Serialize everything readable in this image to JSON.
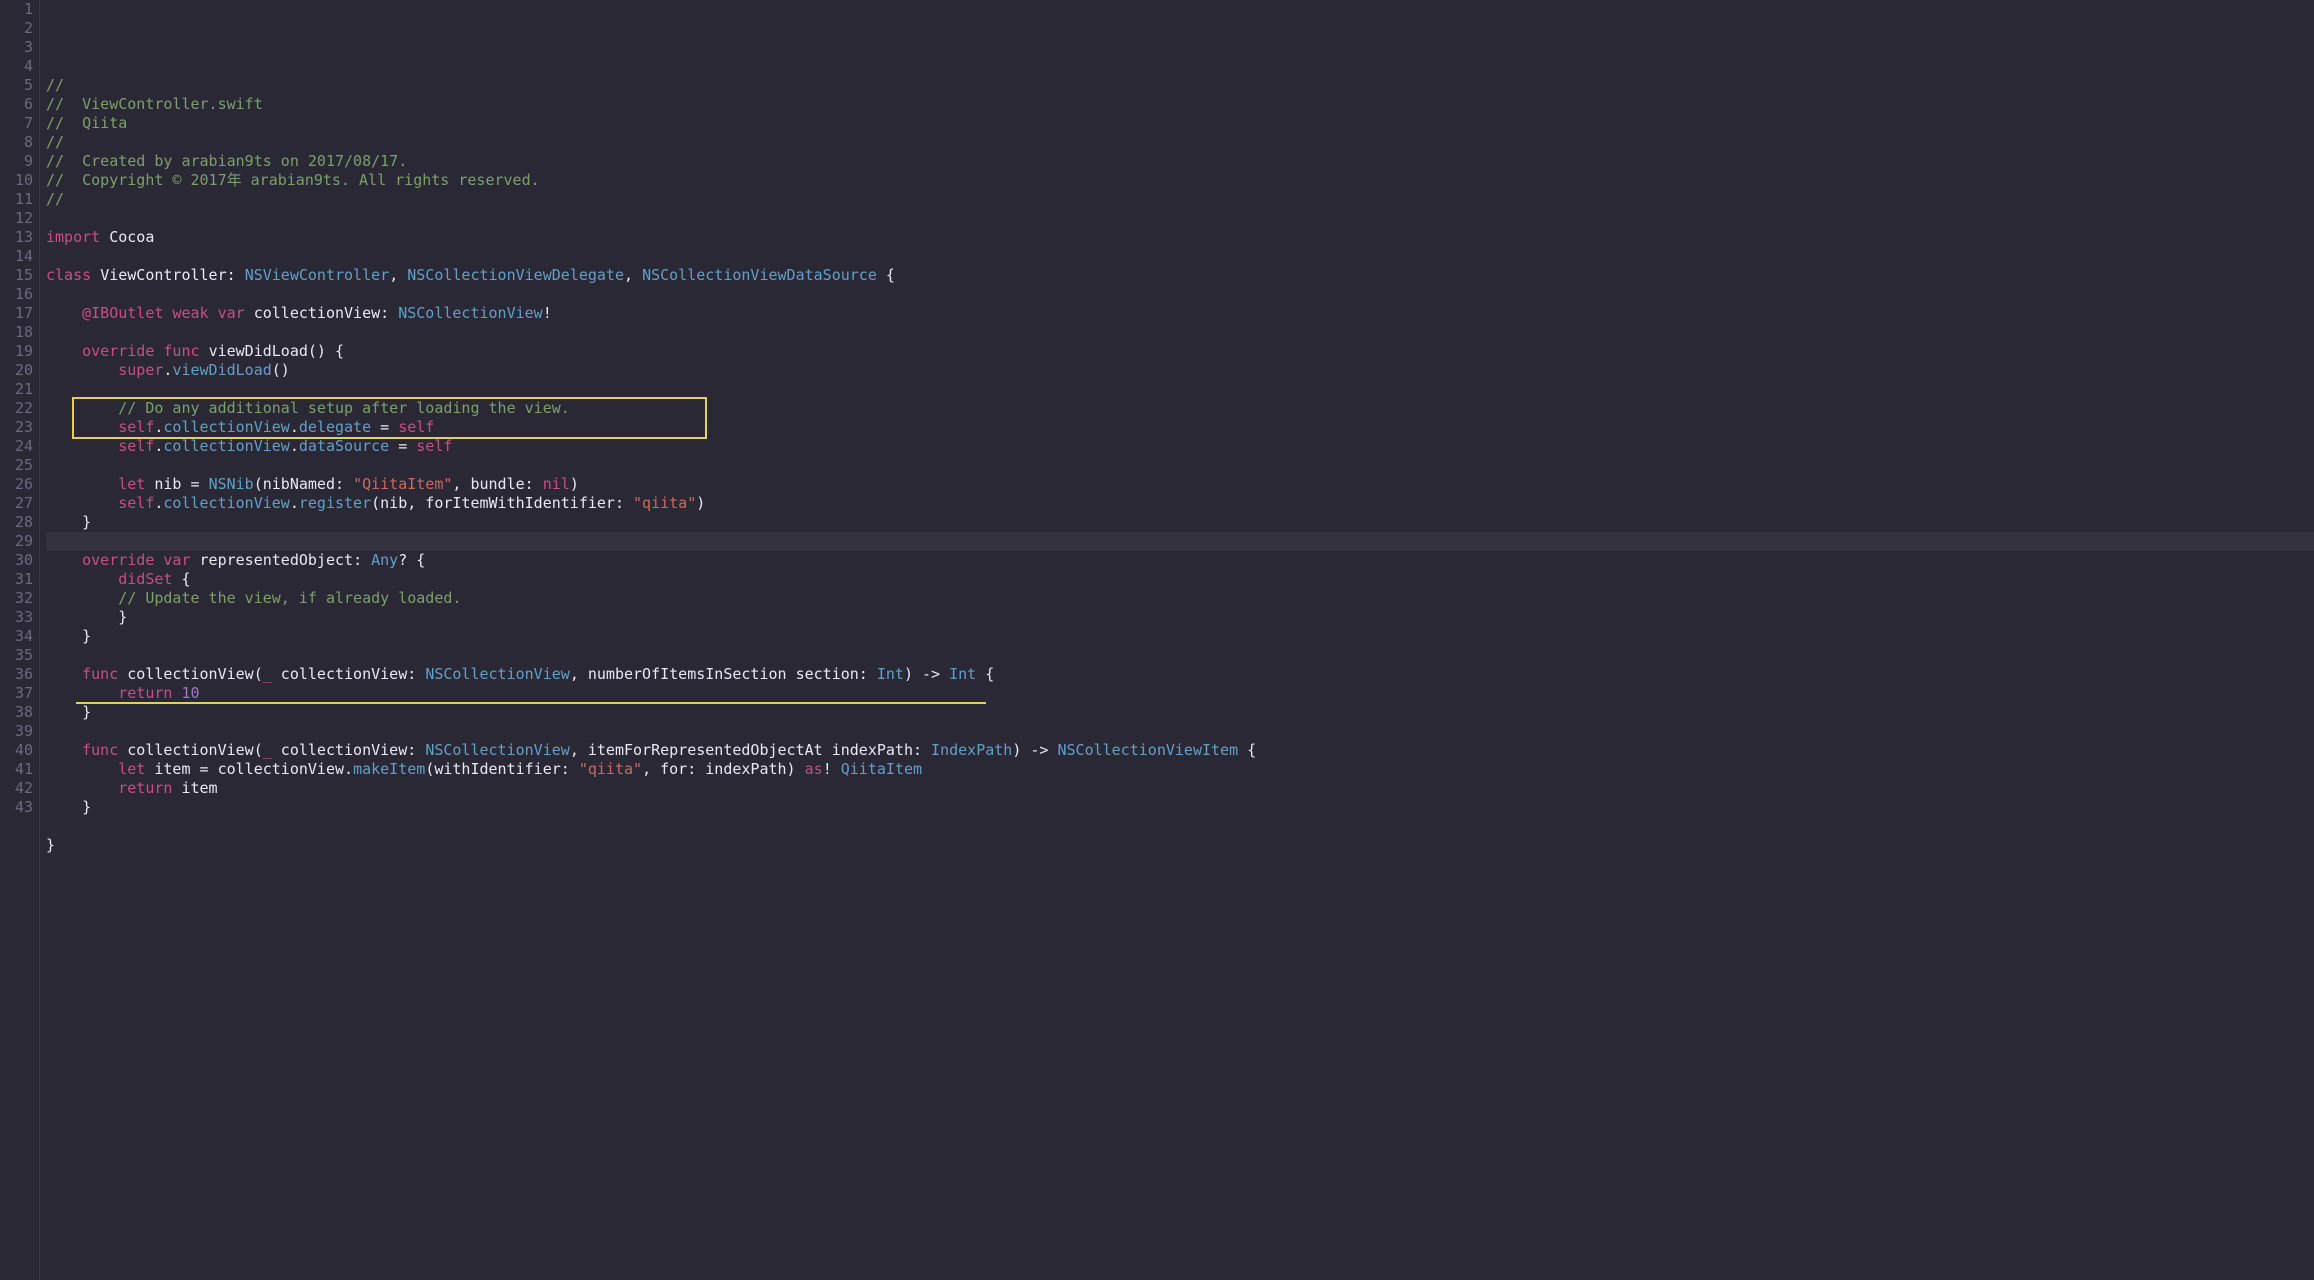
{
  "file": {
    "language": "swift",
    "current_line": 25,
    "breakpoint_line": 13
  },
  "highlight": {
    "box": {
      "top_line": 22,
      "bottom_line": 23
    },
    "underline": {
      "line": 37
    }
  },
  "lines": [
    {
      "n": 1,
      "tokens": [
        {
          "c": "cmt",
          "t": "//"
        }
      ]
    },
    {
      "n": 2,
      "tokens": [
        {
          "c": "cmt",
          "t": "//  ViewController.swift"
        }
      ]
    },
    {
      "n": 3,
      "tokens": [
        {
          "c": "cmt",
          "t": "//  Qiita"
        }
      ]
    },
    {
      "n": 4,
      "tokens": [
        {
          "c": "cmt",
          "t": "//"
        }
      ]
    },
    {
      "n": 5,
      "tokens": [
        {
          "c": "cmt",
          "t": "//  Created by arabian9ts on 2017/08/17."
        }
      ]
    },
    {
      "n": 6,
      "tokens": [
        {
          "c": "cmt",
          "t": "//  Copyright © 2017年 arabian9ts. All rights reserved."
        }
      ]
    },
    {
      "n": 7,
      "tokens": [
        {
          "c": "cmt",
          "t": "//"
        }
      ]
    },
    {
      "n": 8,
      "tokens": []
    },
    {
      "n": 9,
      "tokens": [
        {
          "c": "kwd",
          "t": "import"
        },
        {
          "c": "op",
          "t": " "
        },
        {
          "c": "id",
          "t": "Cocoa"
        }
      ]
    },
    {
      "n": 10,
      "tokens": []
    },
    {
      "n": 11,
      "tokens": [
        {
          "c": "kwd",
          "t": "class"
        },
        {
          "c": "op",
          "t": " "
        },
        {
          "c": "id",
          "t": "ViewController"
        },
        {
          "c": "op",
          "t": ": "
        },
        {
          "c": "typ",
          "t": "NSViewController"
        },
        {
          "c": "op",
          "t": ", "
        },
        {
          "c": "typ",
          "t": "NSCollectionViewDelegate"
        },
        {
          "c": "op",
          "t": ", "
        },
        {
          "c": "typ",
          "t": "NSCollectionViewDataSource"
        },
        {
          "c": "op",
          "t": " {"
        }
      ]
    },
    {
      "n": 12,
      "tokens": []
    },
    {
      "n": 13,
      "tokens": [
        {
          "c": "op",
          "t": "    "
        },
        {
          "c": "attr",
          "t": "@IBOutlet"
        },
        {
          "c": "op",
          "t": " "
        },
        {
          "c": "kwd",
          "t": "weak"
        },
        {
          "c": "op",
          "t": " "
        },
        {
          "c": "kwd",
          "t": "var"
        },
        {
          "c": "op",
          "t": " "
        },
        {
          "c": "id",
          "t": "collectionView"
        },
        {
          "c": "op",
          "t": ": "
        },
        {
          "c": "typ",
          "t": "NSCollectionView"
        },
        {
          "c": "op",
          "t": "!"
        }
      ]
    },
    {
      "n": 14,
      "tokens": []
    },
    {
      "n": 15,
      "tokens": [
        {
          "c": "op",
          "t": "    "
        },
        {
          "c": "kwd",
          "t": "override"
        },
        {
          "c": "op",
          "t": " "
        },
        {
          "c": "kwd",
          "t": "func"
        },
        {
          "c": "op",
          "t": " "
        },
        {
          "c": "id",
          "t": "viewDidLoad"
        },
        {
          "c": "op",
          "t": "() {"
        }
      ]
    },
    {
      "n": 16,
      "tokens": [
        {
          "c": "op",
          "t": "        "
        },
        {
          "c": "kwd",
          "t": "super"
        },
        {
          "c": "op",
          "t": "."
        },
        {
          "c": "fn",
          "t": "viewDidLoad"
        },
        {
          "c": "op",
          "t": "()"
        }
      ]
    },
    {
      "n": 17,
      "tokens": []
    },
    {
      "n": 18,
      "tokens": [
        {
          "c": "op",
          "t": "        "
        },
        {
          "c": "cmt",
          "t": "// Do any additional setup after loading the view."
        }
      ]
    },
    {
      "n": 19,
      "tokens": [
        {
          "c": "op",
          "t": "        "
        },
        {
          "c": "kwd",
          "t": "self"
        },
        {
          "c": "op",
          "t": "."
        },
        {
          "c": "fn",
          "t": "collectionView"
        },
        {
          "c": "op",
          "t": "."
        },
        {
          "c": "fn",
          "t": "delegate"
        },
        {
          "c": "op",
          "t": " = "
        },
        {
          "c": "kwd",
          "t": "self"
        }
      ]
    },
    {
      "n": 20,
      "tokens": [
        {
          "c": "op",
          "t": "        "
        },
        {
          "c": "kwd",
          "t": "self"
        },
        {
          "c": "op",
          "t": "."
        },
        {
          "c": "fn",
          "t": "collectionView"
        },
        {
          "c": "op",
          "t": "."
        },
        {
          "c": "fn",
          "t": "dataSource"
        },
        {
          "c": "op",
          "t": " = "
        },
        {
          "c": "kwd",
          "t": "self"
        }
      ]
    },
    {
      "n": 21,
      "tokens": []
    },
    {
      "n": 22,
      "tokens": [
        {
          "c": "op",
          "t": "        "
        },
        {
          "c": "kwd",
          "t": "let"
        },
        {
          "c": "op",
          "t": " "
        },
        {
          "c": "id",
          "t": "nib"
        },
        {
          "c": "op",
          "t": " = "
        },
        {
          "c": "typ",
          "t": "NSNib"
        },
        {
          "c": "op",
          "t": "(nibNamed: "
        },
        {
          "c": "str",
          "t": "\"QiitaItem\""
        },
        {
          "c": "op",
          "t": ", bundle: "
        },
        {
          "c": "kwd",
          "t": "nil"
        },
        {
          "c": "op",
          "t": ")"
        }
      ]
    },
    {
      "n": 23,
      "tokens": [
        {
          "c": "op",
          "t": "        "
        },
        {
          "c": "kwd",
          "t": "self"
        },
        {
          "c": "op",
          "t": "."
        },
        {
          "c": "fn",
          "t": "collectionView"
        },
        {
          "c": "op",
          "t": "."
        },
        {
          "c": "fn",
          "t": "register"
        },
        {
          "c": "op",
          "t": "(nib, forItemWithIdentifier: "
        },
        {
          "c": "str",
          "t": "\"qiita\""
        },
        {
          "c": "op",
          "t": ")"
        }
      ]
    },
    {
      "n": 24,
      "tokens": [
        {
          "c": "op",
          "t": "    }"
        }
      ]
    },
    {
      "n": 25,
      "tokens": []
    },
    {
      "n": 26,
      "tokens": [
        {
          "c": "op",
          "t": "    "
        },
        {
          "c": "kwd",
          "t": "override"
        },
        {
          "c": "op",
          "t": " "
        },
        {
          "c": "kwd",
          "t": "var"
        },
        {
          "c": "op",
          "t": " "
        },
        {
          "c": "id",
          "t": "representedObject"
        },
        {
          "c": "op",
          "t": ": "
        },
        {
          "c": "typ",
          "t": "Any"
        },
        {
          "c": "op",
          "t": "? {"
        }
      ]
    },
    {
      "n": 27,
      "tokens": [
        {
          "c": "op",
          "t": "        "
        },
        {
          "c": "kwd",
          "t": "didSet"
        },
        {
          "c": "op",
          "t": " {"
        }
      ]
    },
    {
      "n": 28,
      "tokens": [
        {
          "c": "op",
          "t": "        "
        },
        {
          "c": "cmt",
          "t": "// Update the view, if already loaded."
        }
      ]
    },
    {
      "n": 29,
      "tokens": [
        {
          "c": "op",
          "t": "        }"
        }
      ]
    },
    {
      "n": 30,
      "tokens": [
        {
          "c": "op",
          "t": "    }"
        }
      ]
    },
    {
      "n": 31,
      "tokens": []
    },
    {
      "n": 32,
      "tokens": [
        {
          "c": "op",
          "t": "    "
        },
        {
          "c": "kwd",
          "t": "func"
        },
        {
          "c": "op",
          "t": " "
        },
        {
          "c": "id",
          "t": "collectionView"
        },
        {
          "c": "op",
          "t": "("
        },
        {
          "c": "kwd",
          "t": "_"
        },
        {
          "c": "op",
          "t": " collectionView: "
        },
        {
          "c": "typ",
          "t": "NSCollectionView"
        },
        {
          "c": "op",
          "t": ", numberOfItemsInSection section: "
        },
        {
          "c": "typ",
          "t": "Int"
        },
        {
          "c": "op",
          "t": ") -> "
        },
        {
          "c": "typ",
          "t": "Int"
        },
        {
          "c": "op",
          "t": " {"
        }
      ]
    },
    {
      "n": 33,
      "tokens": [
        {
          "c": "op",
          "t": "        "
        },
        {
          "c": "kwd",
          "t": "return"
        },
        {
          "c": "op",
          "t": " "
        },
        {
          "c": "num",
          "t": "10"
        }
      ]
    },
    {
      "n": 34,
      "tokens": [
        {
          "c": "op",
          "t": "    }"
        }
      ]
    },
    {
      "n": 35,
      "tokens": []
    },
    {
      "n": 36,
      "tokens": [
        {
          "c": "op",
          "t": "    "
        },
        {
          "c": "kwd",
          "t": "func"
        },
        {
          "c": "op",
          "t": " "
        },
        {
          "c": "id",
          "t": "collectionView"
        },
        {
          "c": "op",
          "t": "("
        },
        {
          "c": "kwd",
          "t": "_"
        },
        {
          "c": "op",
          "t": " collectionView: "
        },
        {
          "c": "typ",
          "t": "NSCollectionView"
        },
        {
          "c": "op",
          "t": ", itemForRepresentedObjectAt indexPath: "
        },
        {
          "c": "typ",
          "t": "IndexPath"
        },
        {
          "c": "op",
          "t": ") -> "
        },
        {
          "c": "typ",
          "t": "NSCollectionViewItem"
        },
        {
          "c": "op",
          "t": " {"
        }
      ]
    },
    {
      "n": 37,
      "tokens": [
        {
          "c": "op",
          "t": "        "
        },
        {
          "c": "kwd",
          "t": "let"
        },
        {
          "c": "op",
          "t": " "
        },
        {
          "c": "id",
          "t": "item"
        },
        {
          "c": "op",
          "t": " = collectionView."
        },
        {
          "c": "fn",
          "t": "makeItem"
        },
        {
          "c": "op",
          "t": "(withIdentifier: "
        },
        {
          "c": "str",
          "t": "\"qiita\""
        },
        {
          "c": "op",
          "t": ", for: indexPath) "
        },
        {
          "c": "kwd",
          "t": "as"
        },
        {
          "c": "op",
          "t": "! "
        },
        {
          "c": "typ",
          "t": "QiitaItem"
        }
      ]
    },
    {
      "n": 38,
      "tokens": [
        {
          "c": "op",
          "t": "        "
        },
        {
          "c": "kwd",
          "t": "return"
        },
        {
          "c": "op",
          "t": " "
        },
        {
          "c": "id",
          "t": "item"
        }
      ]
    },
    {
      "n": 39,
      "tokens": [
        {
          "c": "op",
          "t": "    }"
        }
      ]
    },
    {
      "n": 40,
      "tokens": []
    },
    {
      "n": 41,
      "tokens": [
        {
          "c": "op",
          "t": "}"
        }
      ]
    },
    {
      "n": 42,
      "tokens": []
    },
    {
      "n": 43,
      "tokens": []
    }
  ]
}
